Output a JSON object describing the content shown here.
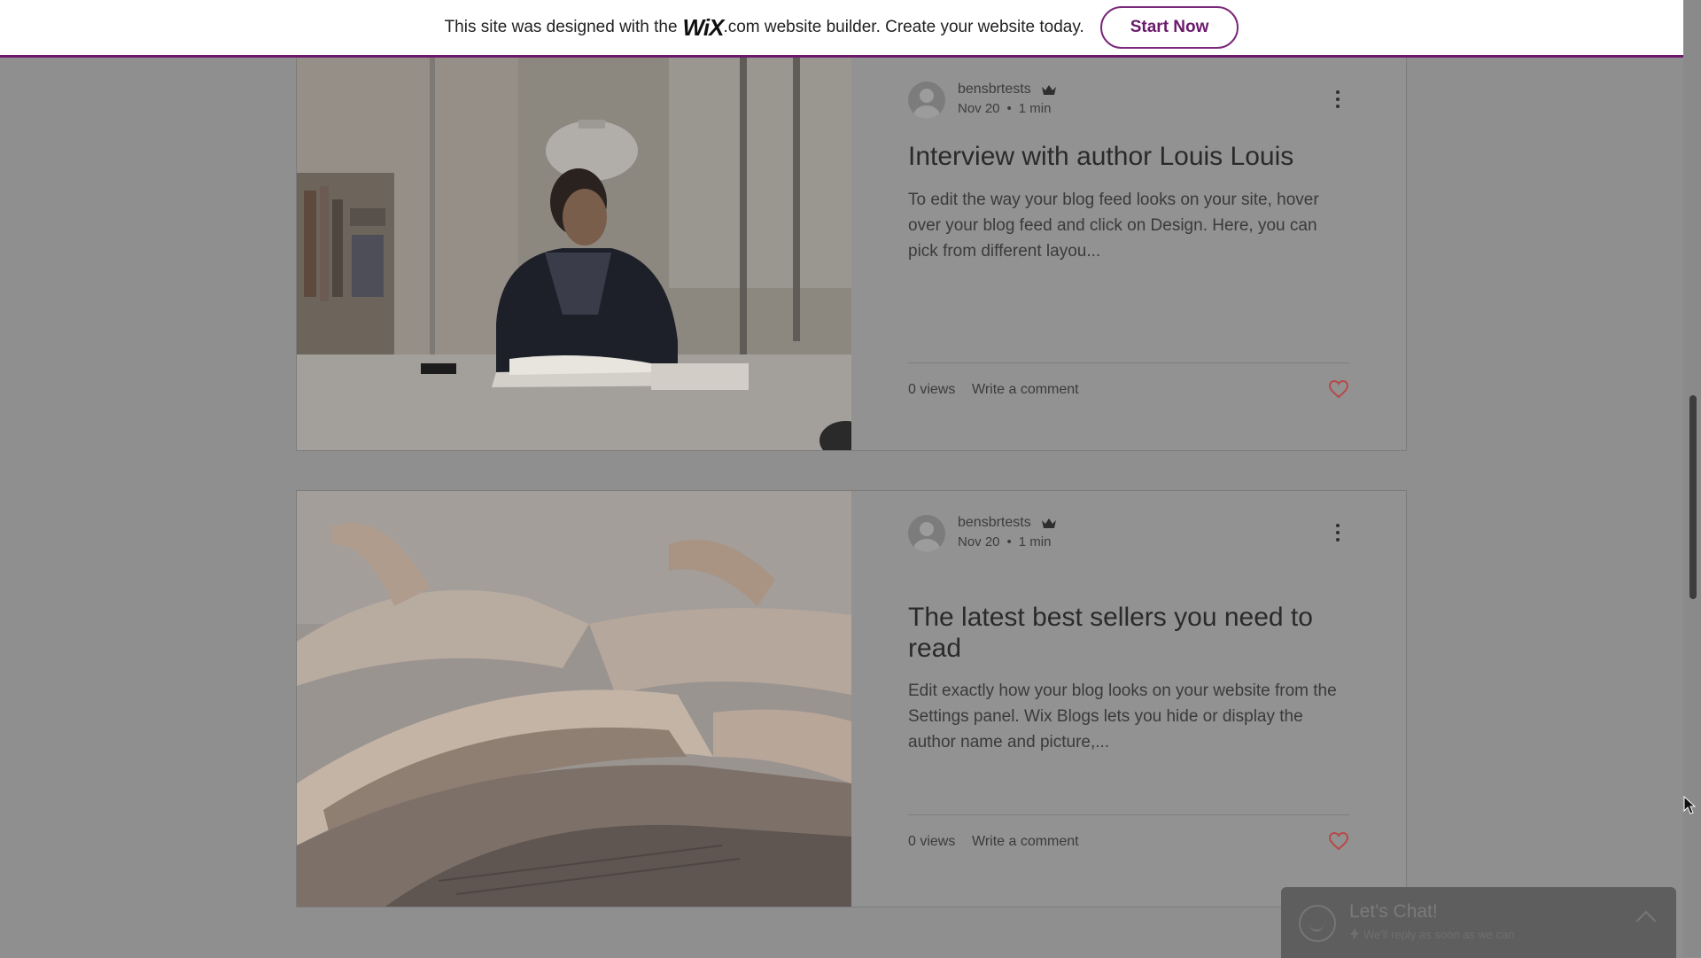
{
  "banner": {
    "text_before": "This site was designed with the",
    "logo": "WiX",
    "text_after": ".com website builder. Create your website today.",
    "button": "Start Now",
    "accent_color": "#6b1a6b"
  },
  "posts": [
    {
      "author": "bensbrtests",
      "date": "Nov 20",
      "separator": "•",
      "read_time": "1 min",
      "title": "Interview with author Louis Louis",
      "excerpt": "To edit the way your blog feed looks on your site, hover over your blog feed and click on Design. Here, you can pick from different layou...",
      "views": "0 views",
      "comment_link": "Write a comment",
      "image": "man-reading-in-library"
    },
    {
      "author": "bensbrtests",
      "date": "Nov 20",
      "separator": "•",
      "read_time": "1 min",
      "title": "The latest best sellers you need to read",
      "excerpt": "Edit exactly how your blog looks on your website from the Settings panel. Wix Blogs lets you hide or display the author name and picture,...",
      "views": "0 views",
      "comment_link": "Write a comment",
      "image": "open-books-closeup"
    }
  ],
  "chat": {
    "title": "Let's Chat!",
    "subtitle": "We'll reply as soon as we can"
  },
  "icons": {
    "crown": "crown-icon",
    "more": "more-vertical-icon",
    "heart": "heart-icon",
    "heart_color": "#c44a4a",
    "chevron": "chevron-up-icon",
    "bolt": "bolt-icon"
  }
}
